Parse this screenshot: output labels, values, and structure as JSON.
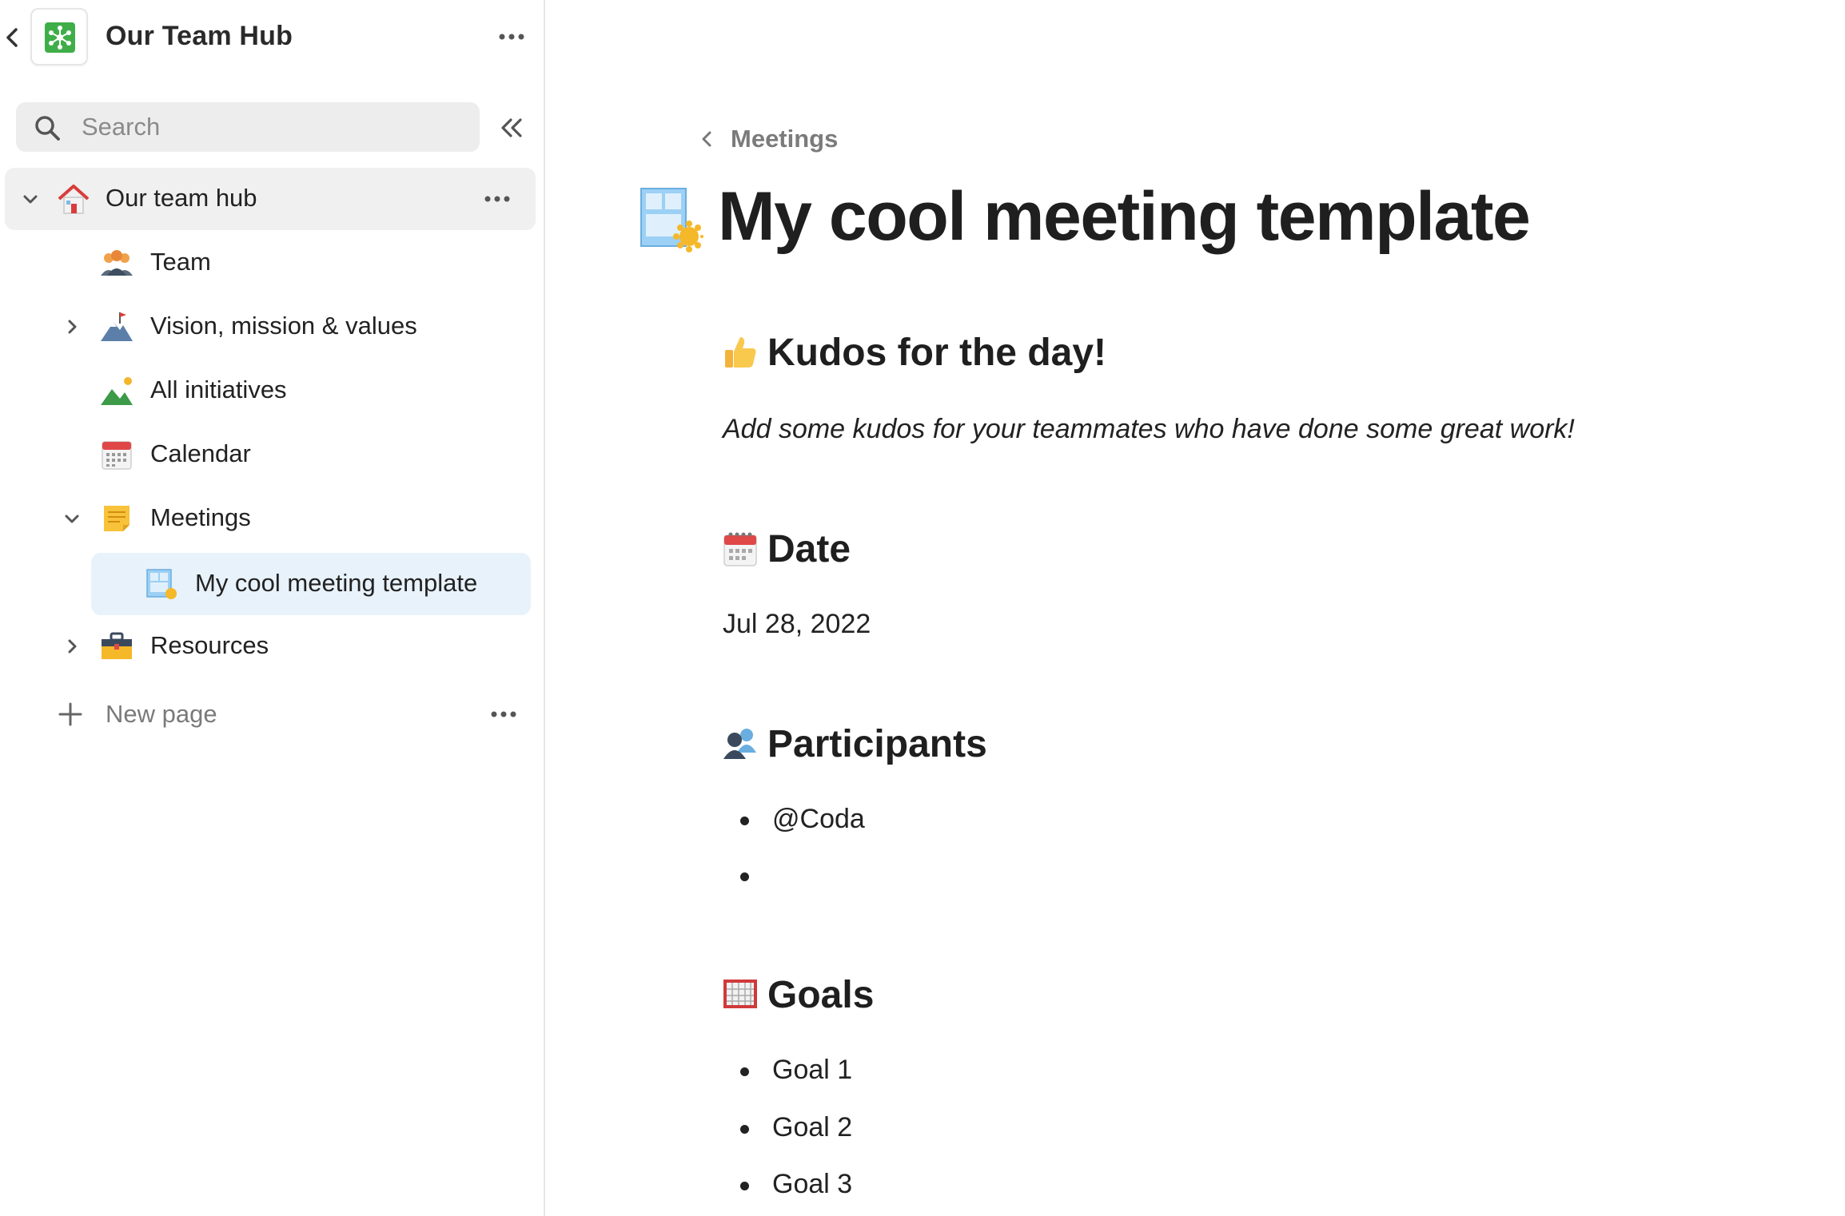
{
  "sidebar": {
    "hub_title": "Our Team Hub",
    "search_placeholder": "Search",
    "items": [
      {
        "label": "Our team hub",
        "icon": "house-icon"
      },
      {
        "label": "Team",
        "icon": "people-icon"
      },
      {
        "label": "Vision, mission & values",
        "icon": "mountain-flag-icon"
      },
      {
        "label": "All initiatives",
        "icon": "landscape-icon"
      },
      {
        "label": "Calendar",
        "icon": "calendar-icon"
      },
      {
        "label": "Meetings",
        "icon": "sticky-note-icon"
      },
      {
        "label": "My cool meeting template",
        "icon": "template-icon"
      },
      {
        "label": "Resources",
        "icon": "toolbox-icon"
      }
    ],
    "new_page_label": "New page"
  },
  "main": {
    "breadcrumb": "Meetings",
    "page_title": "My cool meeting template",
    "sections": {
      "kudos": {
        "heading": "Kudos for the day!",
        "icon": "thumbs-up-icon",
        "text": "Add some kudos for your teammates who have done some great work!"
      },
      "date": {
        "heading": "Date",
        "icon": "calendar-icon",
        "value": "Jul 28, 2022"
      },
      "participants": {
        "heading": "Participants",
        "icon": "people-icon",
        "items": [
          "@Coda",
          ""
        ]
      },
      "goals": {
        "heading": "Goals",
        "icon": "goal-net-icon",
        "items": [
          "Goal 1",
          "Goal 2",
          "Goal 3"
        ]
      }
    }
  },
  "colors": {
    "active_item_bg": "#e8f2fb",
    "root_item_bg": "#f0f0f0",
    "logo_green": "#3fae49"
  }
}
